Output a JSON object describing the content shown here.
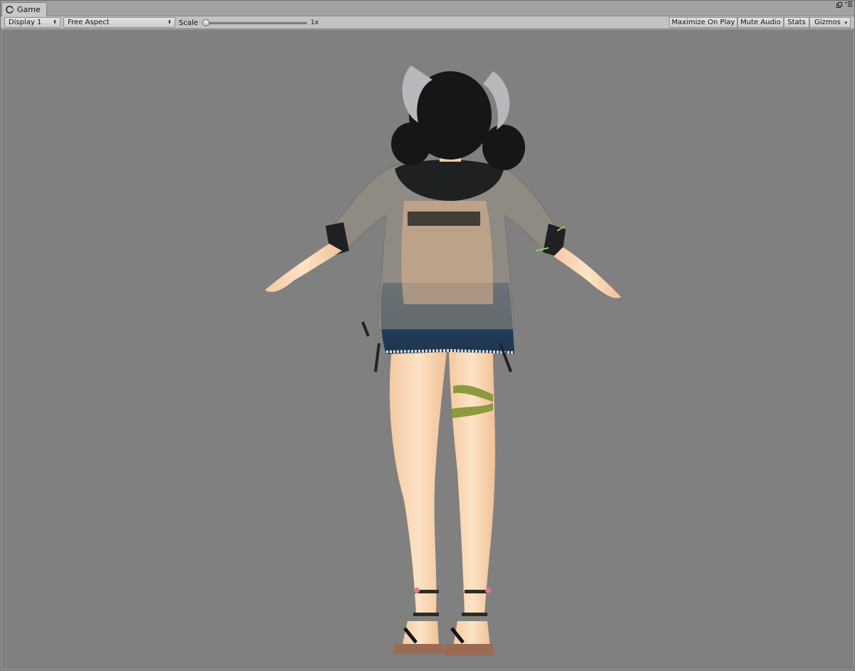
{
  "window": {
    "tab_title": "Game",
    "tab_icon": "game-icon",
    "controls": [
      "maximize-icon",
      "menu-icon"
    ]
  },
  "toolbar": {
    "display_label": "Display 1",
    "aspect_label": "Free Aspect",
    "scale_label": "Scale",
    "scale_value": "1x",
    "scale_fraction": 0,
    "maximize_label": "Maximize On Play",
    "mute_label": "Mute Audio",
    "stats_label": "Stats",
    "gizmos_label": "Gizmos"
  },
  "viewport": {
    "background": "#808080",
    "content": "3d-character-model"
  }
}
